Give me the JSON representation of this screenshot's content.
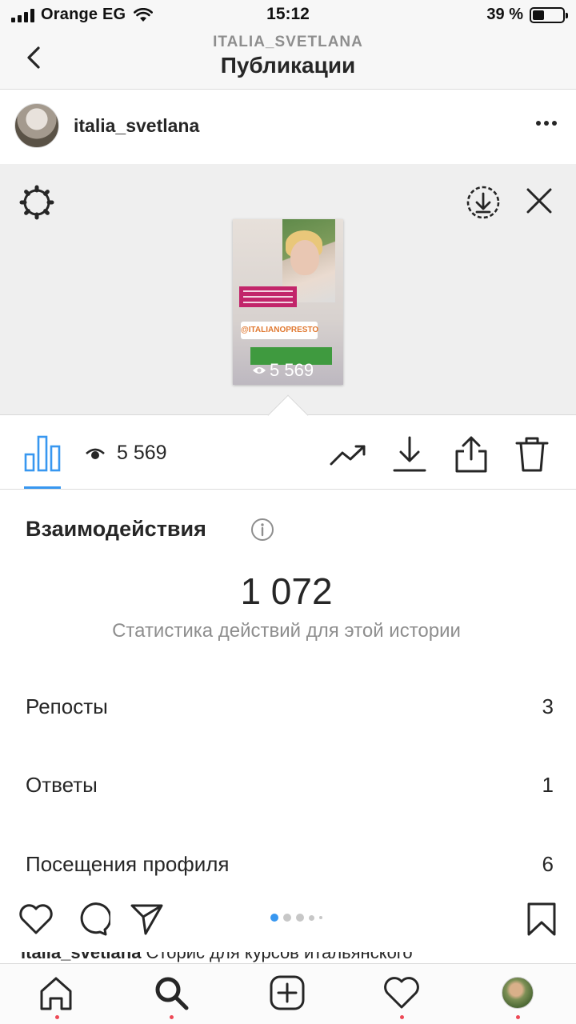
{
  "status_bar": {
    "carrier": "Orange EG",
    "time": "15:12",
    "battery_percent": "39 %",
    "battery_level": 0.39
  },
  "header": {
    "subtitle": "ITALIA_SVETLANA",
    "title": "Публикации"
  },
  "post": {
    "username": "italia_svetlana"
  },
  "story_preview": {
    "tag_text": "@ITALIANOPRESTO",
    "views": "5 569"
  },
  "toolbar": {
    "viewers_count": "5 569"
  },
  "interactions": {
    "title": "Взаимодействия",
    "total": "1 072",
    "caption": "Статистика действий для этой истории",
    "rows": [
      {
        "label": "Репосты",
        "value": "3"
      },
      {
        "label": "Ответы",
        "value": "1"
      },
      {
        "label": "Посещения профиля",
        "value": "6"
      }
    ]
  },
  "caption_peek": {
    "username": "italia_svetlana",
    "text": " Сторис для курсов итальянского"
  },
  "icons": {
    "back": "chevron-left-icon",
    "more": "more-horizontal-icon",
    "settings": "gear-icon",
    "download_circle": "download-circle-icon",
    "close": "close-icon",
    "stats": "bar-chart-icon",
    "eye": "eye-icon",
    "promote": "trending-up-icon",
    "download": "download-icon",
    "share": "share-icon",
    "delete": "trash-icon",
    "info": "info-icon",
    "like": "heart-icon",
    "comment": "comment-icon",
    "send": "send-icon",
    "save": "bookmark-icon",
    "home": "home-icon",
    "search": "search-icon",
    "new_post": "add-post-icon",
    "activity": "heart-icon",
    "profile": "avatar"
  },
  "colors": {
    "accent": "#3897f0",
    "notification_dot": "#ed4956",
    "text_primary": "#262626",
    "text_secondary": "#8e8e8e"
  }
}
